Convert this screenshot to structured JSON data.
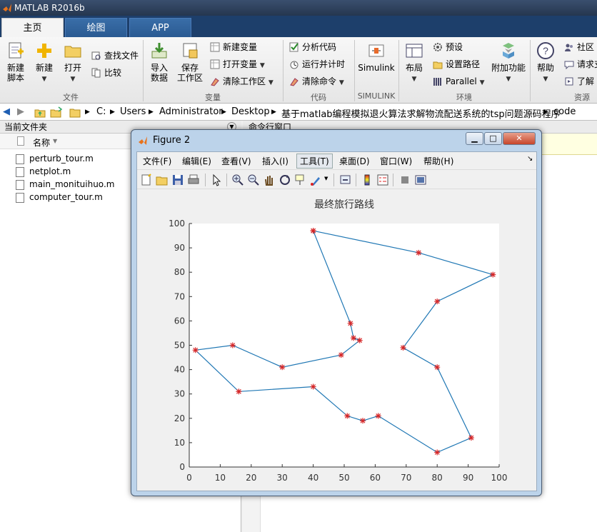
{
  "window": {
    "title": "MATLAB R2016b"
  },
  "tabs": [
    {
      "label": "主页"
    },
    {
      "label": "绘图"
    },
    {
      "label": "APP"
    }
  ],
  "ribbon": {
    "new_script": "新建\n脚本",
    "new": "新建",
    "open": "打开",
    "find_files": "查找文件",
    "compare": "比较",
    "file_group": "文件",
    "import_data": "导入\n数据",
    "save_workspace": "保存\n工作区",
    "new_variable": "新建变量",
    "open_variable": "打开变量",
    "clear_workspace": "清除工作区",
    "variable_group": "变量",
    "analyze_code": "分析代码",
    "run_and_time": "运行并计时",
    "clear_commands": "清除命令",
    "code_group": "代码",
    "simulink": "Simulink",
    "simulink_group": "SIMULINK",
    "layout": "布局",
    "preferences": "预设",
    "set_path": "设置路径",
    "parallel": "Parallel",
    "env_group": "环境",
    "addons": "附加功能",
    "help": "帮助",
    "community": "社区",
    "request_support": "请求支",
    "learn": "了解",
    "resources_group": "资源"
  },
  "address": {
    "crumbs": [
      "C:",
      "Users",
      "Administrator",
      "Desktop",
      "基于matlab编程模拟退火算法求解物流配送系统的tsp问题源码程序",
      "code"
    ]
  },
  "file_panel": {
    "title": "当前文件夹",
    "name_col": "名称",
    "files": [
      "perturb_tour.m",
      "netplot.m",
      "main_monituihuo.m",
      "computer_tour.m"
    ]
  },
  "command_panel": {
    "title": "命令行窗口"
  },
  "figure": {
    "title": "Figure 2",
    "menu": [
      "文件(F)",
      "编辑(E)",
      "查看(V)",
      "插入(I)",
      "工具(T)",
      "桌面(D)",
      "窗口(W)",
      "帮助(H)"
    ]
  },
  "colors": {
    "line": "#1f77b4",
    "marker": "#d62728",
    "tab_bar": "#1d3f6b"
  },
  "icons": [
    "matlab-logo-icon",
    "new-figure-icon",
    "open-file-icon",
    "save-icon",
    "print-icon",
    "pointer-icon",
    "zoom-in-icon",
    "zoom-out-icon",
    "pan-icon",
    "rotate-icon",
    "data-cursor-icon",
    "brush-icon",
    "link-plot-icon",
    "colorbar-icon",
    "legend-icon",
    "hide-plot-tools-icon",
    "show-plot-tools-icon"
  ],
  "chart_data": {
    "type": "line",
    "title": "最终旅行路线",
    "xlabel": "",
    "ylabel": "",
    "xlim": [
      0,
      100
    ],
    "ylim": [
      0,
      100
    ],
    "xticks": [
      0,
      10,
      20,
      30,
      40,
      50,
      60,
      70,
      80,
      90,
      100
    ],
    "yticks": [
      0,
      10,
      20,
      30,
      40,
      50,
      60,
      70,
      80,
      90,
      100
    ],
    "grid": false,
    "marker": "*",
    "x": [
      40,
      74,
      98,
      80,
      69,
      80,
      91,
      80,
      61,
      56,
      51,
      40,
      16,
      2,
      14,
      30,
      49,
      55,
      53,
      52,
      40
    ],
    "y": [
      97,
      88,
      79,
      68,
      49,
      41,
      12,
      6,
      21,
      19,
      21,
      33,
      31,
      48,
      50,
      41,
      46,
      52,
      53,
      59,
      97
    ]
  }
}
